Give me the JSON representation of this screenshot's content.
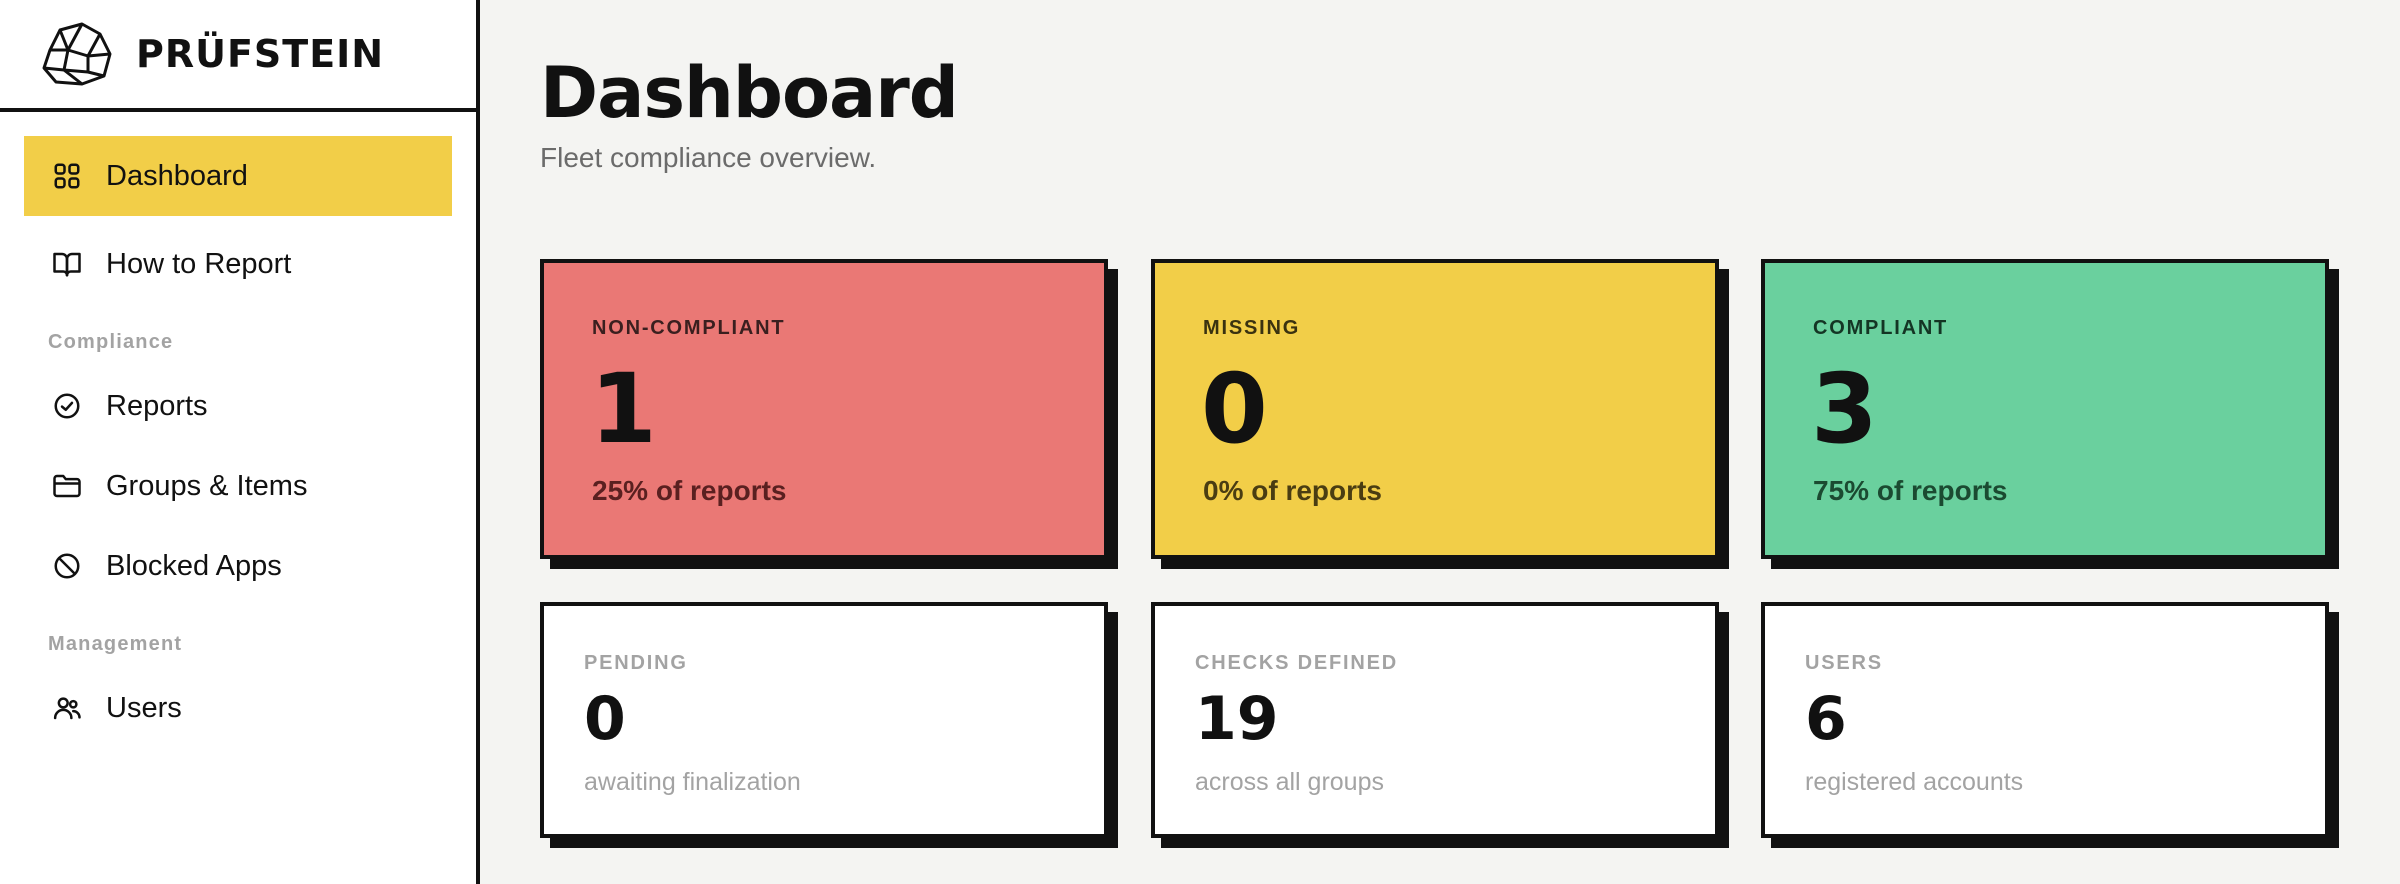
{
  "brand": {
    "name": "PRÜFSTEIN"
  },
  "sidebar": {
    "items": [
      {
        "label": "Dashboard",
        "icon": "grid-icon",
        "active": true
      },
      {
        "label": "How to Report",
        "icon": "book-icon"
      }
    ],
    "sections": [
      {
        "title": "Compliance",
        "items": [
          {
            "label": "Reports",
            "icon": "check-circle-icon"
          },
          {
            "label": "Groups & Items",
            "icon": "folder-icon"
          },
          {
            "label": "Blocked Apps",
            "icon": "ban-icon"
          }
        ]
      },
      {
        "title": "Management",
        "items": [
          {
            "label": "Users",
            "icon": "users-icon"
          }
        ]
      }
    ]
  },
  "page": {
    "title": "Dashboard",
    "subtitle": "Fleet compliance overview."
  },
  "stats": {
    "non_compliant": {
      "label": "NON-COMPLIANT",
      "value": "1",
      "note": "25% of reports",
      "color": "#ea7875"
    },
    "missing": {
      "label": "MISSING",
      "value": "0",
      "note": "0% of reports",
      "color": "#f2ce48"
    },
    "compliant": {
      "label": "COMPLIANT",
      "value": "3",
      "note": "75% of reports",
      "color": "#6ad09e"
    },
    "pending": {
      "label": "PENDING",
      "value": "0",
      "note": "awaiting finalization"
    },
    "checks": {
      "label": "CHECKS DEFINED",
      "value": "19",
      "note": "across all groups"
    },
    "users": {
      "label": "USERS",
      "value": "6",
      "note": "registered accounts"
    }
  },
  "colors": {
    "accent": "#f2ce48",
    "border": "#111111",
    "muted": "#a3a3a3"
  }
}
